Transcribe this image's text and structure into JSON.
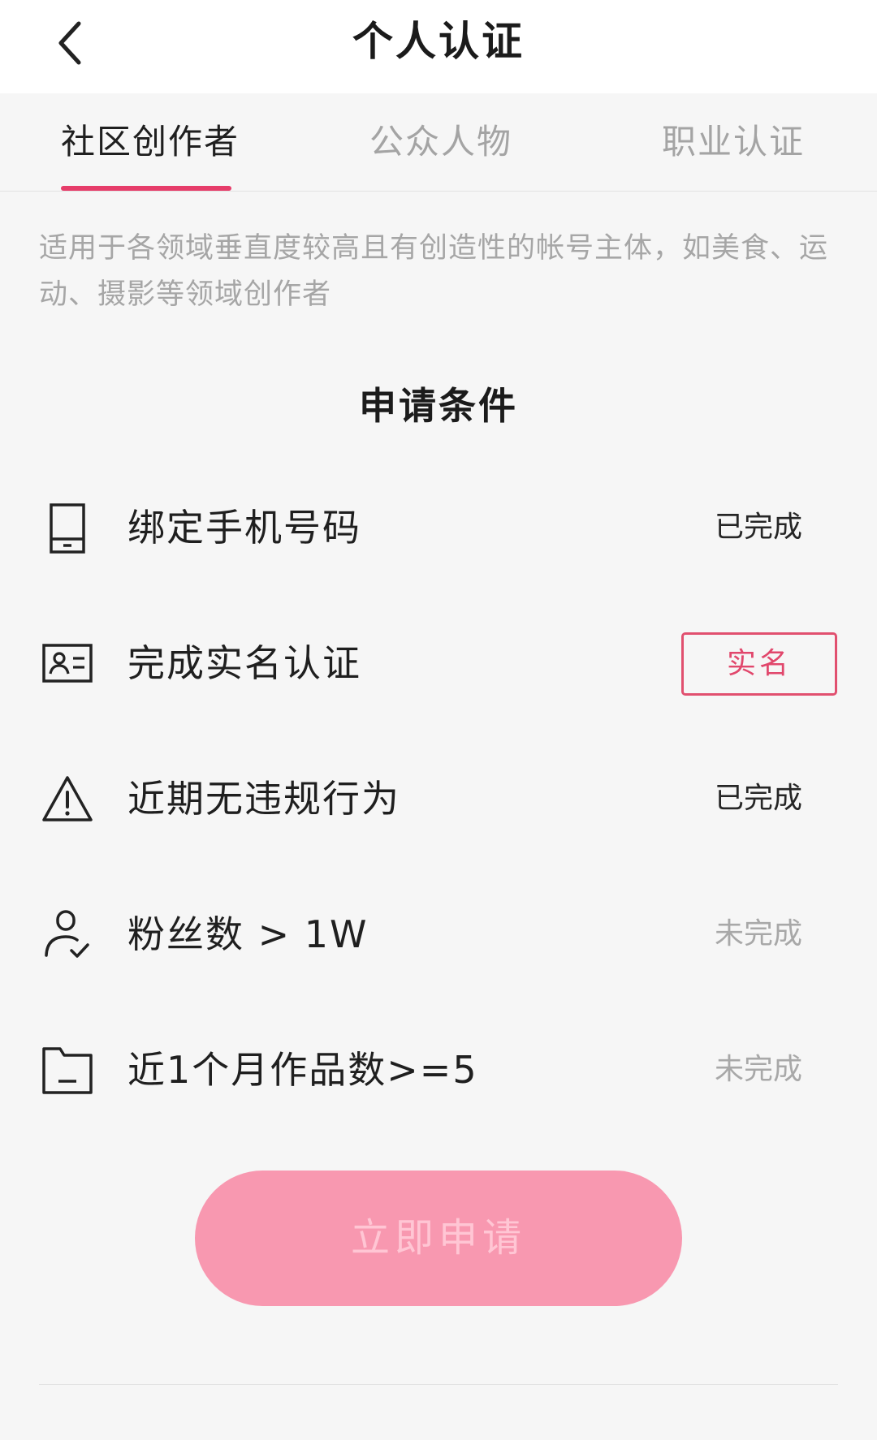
{
  "header": {
    "back_icon": "chevron-left-icon",
    "title": "个人认证"
  },
  "tabs": [
    {
      "label": "社区创作者",
      "active": true
    },
    {
      "label": "公众人物",
      "active": false
    },
    {
      "label": "职业认证",
      "active": false
    }
  ],
  "accent_color": "#e63d6a",
  "description": "适用于各领域垂直度较高且有创造性的帐号主体，如美食、运动、摄影等领域创作者",
  "section_title": "申请条件",
  "conditions": [
    {
      "icon": "phone-icon",
      "label": "绑定手机号码",
      "status": "已完成",
      "done": true
    },
    {
      "icon": "id-card-icon",
      "label": "完成实名认证",
      "action_label": "实名",
      "done": false
    },
    {
      "icon": "warning-icon",
      "label": "近期无违规行为",
      "status": "已完成",
      "done": true
    },
    {
      "icon": "user-check-icon",
      "label": "粉丝数 > 1W",
      "status": "未完成",
      "done": false
    },
    {
      "icon": "folder-icon",
      "label": "近1个月作品数>=5",
      "status": "未完成",
      "done": false
    }
  ],
  "apply_button": {
    "label": "立即申请",
    "color": "#f898b0"
  }
}
